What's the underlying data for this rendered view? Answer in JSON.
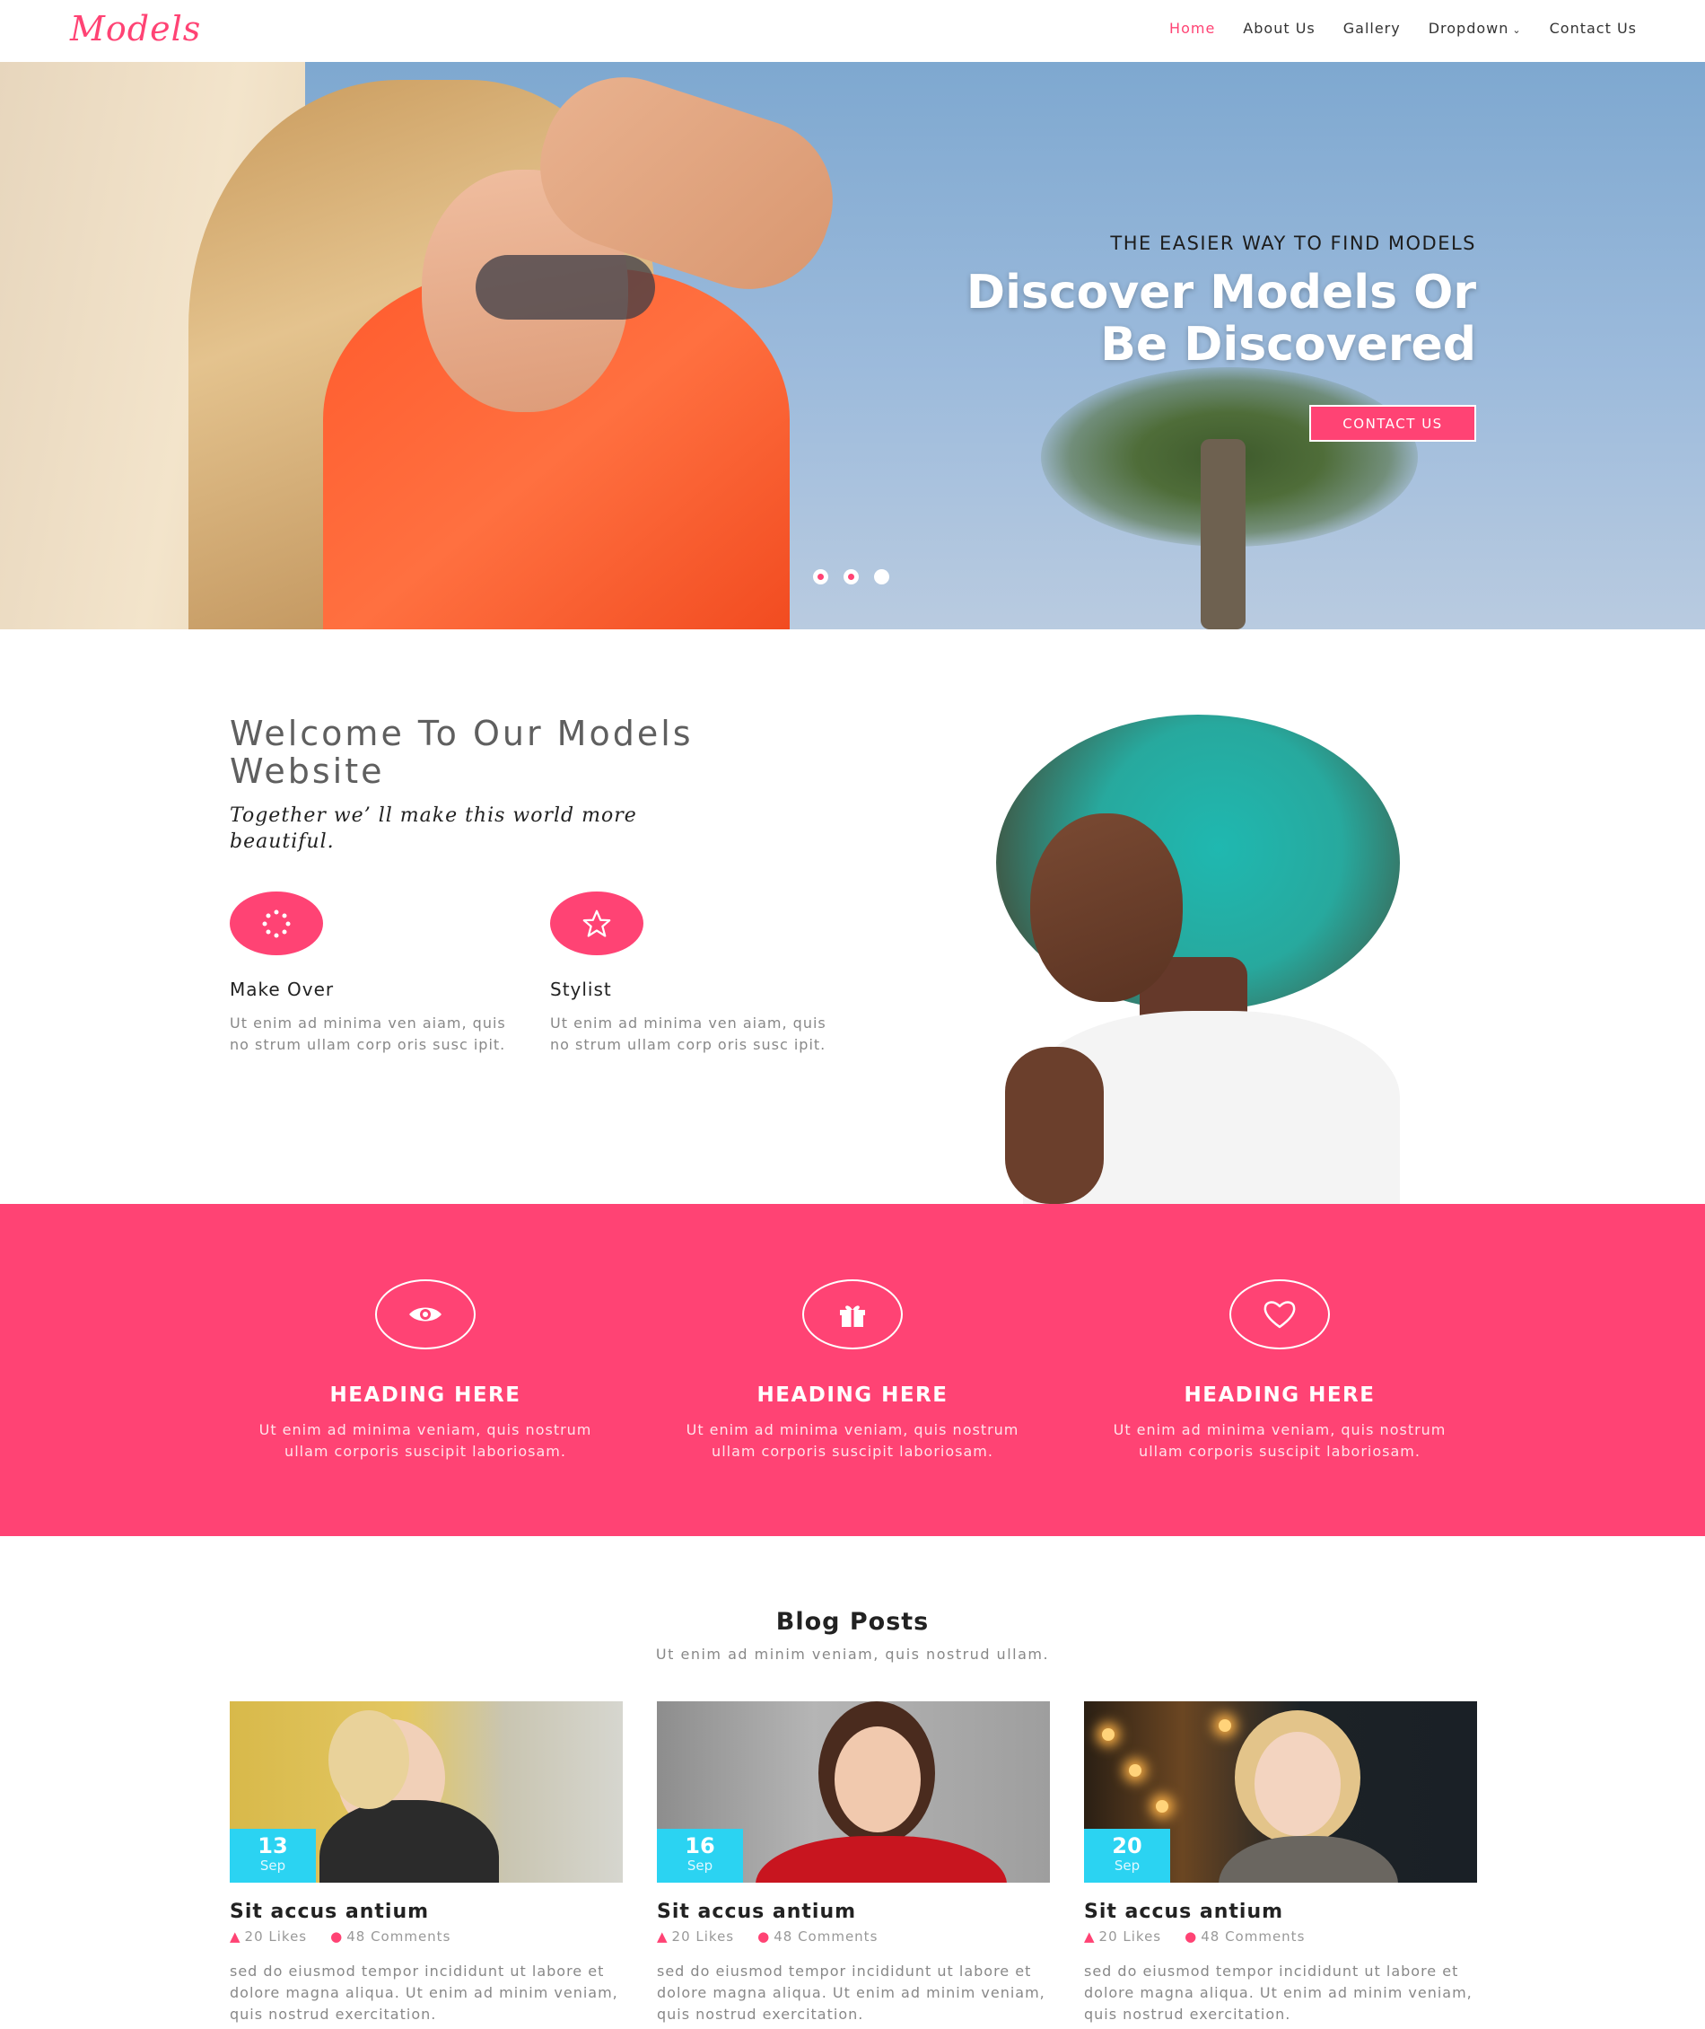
{
  "brand": {
    "logo_text": "Models",
    "accent": "#ff4374",
    "date_badge": "#2bd3f2"
  },
  "nav": {
    "items": [
      {
        "label": "Home",
        "active": true
      },
      {
        "label": "About Us",
        "active": false
      },
      {
        "label": "Gallery",
        "active": false
      },
      {
        "label": "Dropdown",
        "active": false
      },
      {
        "label": "Contact Us",
        "active": false
      }
    ],
    "dropdown_icon": "chevron-down-icon"
  },
  "hero": {
    "tagline": "THE EASIER WAY TO FIND MODELS",
    "title_line1": "Discover Models Or",
    "title_line2": "Be Discovered",
    "button_label": "CONTACT US",
    "slides": 3,
    "active_slide": 1
  },
  "welcome": {
    "title": "Welcome To Our Models Website",
    "subtitle": "Together we’ ll make this world more beautiful.",
    "features": [
      {
        "icon": "loader-icon",
        "name": "Make Over",
        "desc": "Ut enim ad minima ven aiam, quis no strum ullam corp oris susc ipit."
      },
      {
        "icon": "star-icon",
        "name": "Stylist",
        "desc": "Ut enim ad minima ven aiam, quis no strum ullam corp oris susc ipit."
      }
    ]
  },
  "services": [
    {
      "icon": "eye-icon",
      "heading": "HEADING HERE",
      "desc": "Ut enim ad minima veniam, quis nostrum ullam corporis suscipit laboriosam."
    },
    {
      "icon": "gift-icon",
      "heading": "HEADING HERE",
      "desc": "Ut enim ad minima veniam, quis nostrum ullam corporis suscipit laboriosam."
    },
    {
      "icon": "heart-icon",
      "heading": "HEADING HERE",
      "desc": "Ut enim ad minima veniam, quis nostrum ullam corporis suscipit laboriosam."
    }
  ],
  "blog": {
    "title": "Blog Posts",
    "subtitle": "Ut enim ad minim veniam, quis nostrud ullam.",
    "posts": [
      {
        "day": "13",
        "month": "Sep",
        "title": "Sit accus antium",
        "likes": "20 Likes",
        "comments": "48 Comments",
        "text": "sed do eiusmod tempor incididunt ut labore et dolore magna aliqua. Ut enim ad minim veniam, quis nostrud exercitation."
      },
      {
        "day": "16",
        "month": "Sep",
        "title": "Sit accus antium",
        "likes": "20 Likes",
        "comments": "48 Comments",
        "text": "sed do eiusmod tempor incididunt ut labore et dolore magna aliqua. Ut enim ad minim veniam, quis nostrud exercitation."
      },
      {
        "day": "20",
        "month": "Sep",
        "title": "Sit accus antium",
        "likes": "20 Likes",
        "comments": "48 Comments",
        "text": "sed do eiusmod tempor incididunt ut labore et dolore magna aliqua. Ut enim ad minim veniam, quis nostrud exercitation."
      }
    ]
  }
}
